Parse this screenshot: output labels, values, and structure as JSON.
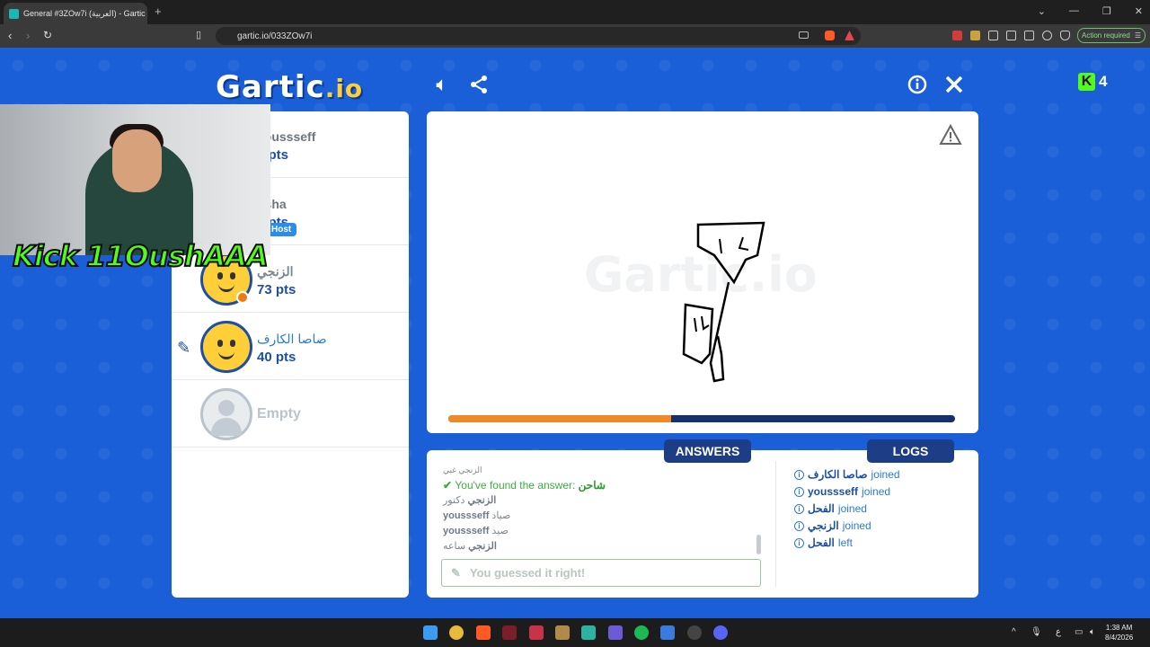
{
  "browser": {
    "tab_title": "General #3ZOw7i (العربية) - Gartic",
    "url": "gartic.io/033ZOw7i",
    "action_required": "Action required"
  },
  "game": {
    "logo_main": "Gartic",
    "logo_suffix": ".io",
    "kick_count": "4",
    "kick_letter": "K",
    "streamer_overlay": "Kick 11OushAAA",
    "players": [
      {
        "name": "youssseff",
        "pts": "2 pts"
      },
      {
        "name": "usha",
        "pts": "0 pts",
        "badge": "Host"
      },
      {
        "name": "الزنجي",
        "pts": "73 pts"
      },
      {
        "name": "صاصا الكارف",
        "pts": "40 pts"
      },
      {
        "name": "Empty",
        "pts": ""
      }
    ],
    "canvas_watermark": "Gartic.io",
    "round_progress": 0.44,
    "tabs": {
      "answers": "ANSWERS",
      "logs": "LOGS"
    },
    "answers": [
      {
        "user": "",
        "text": "الزنجي غبي",
        "type": "small"
      },
      {
        "user": "",
        "text": "You've found the answer: ",
        "answer": "شاحن",
        "type": "found"
      },
      {
        "user": "الزنجي",
        "text": "دكتور",
        "type": "normal"
      },
      {
        "user": "youssseff",
        "text": "صياد",
        "type": "normal"
      },
      {
        "user": "youssseff",
        "text": "صيد",
        "type": "normal"
      },
      {
        "user": "الزنجي",
        "text": "ساعه",
        "type": "normal"
      }
    ],
    "guess_placeholder": "You guessed it right!",
    "logs": [
      {
        "user": "صاصا الكارف",
        "action": "joined"
      },
      {
        "user": "youssseff",
        "action": "joined"
      },
      {
        "user": "الفحل",
        "action": "joined"
      },
      {
        "user": "الزنجي",
        "action": "joined"
      },
      {
        "user": "الفحل",
        "action": "left"
      }
    ]
  },
  "taskbar": {
    "time": "1:38 AM",
    "date": "8/4/2026",
    "lang": "ع"
  },
  "colors": {
    "background": "#1a5fd8",
    "accent_blue": "#1d3d86",
    "progress_fill": "#ef8a2a",
    "found_green": "#3cad3f"
  }
}
